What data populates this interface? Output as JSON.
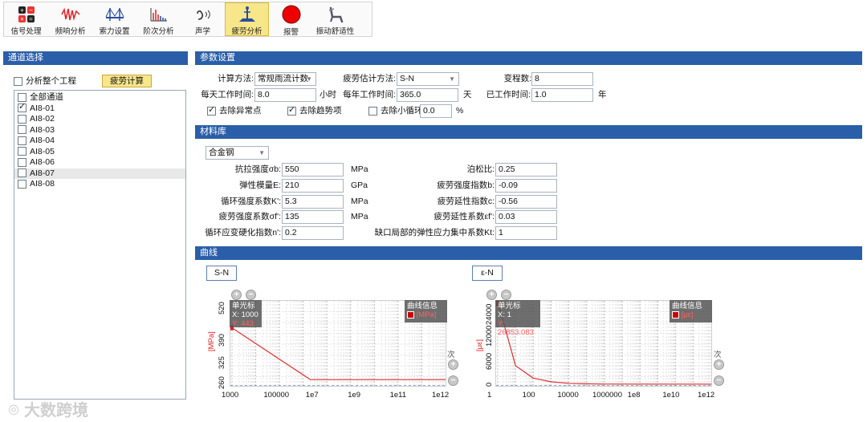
{
  "toolbar": {
    "items": [
      {
        "label": "信号处理",
        "icon": "signal-processing-icon"
      },
      {
        "label": "频响分析",
        "icon": "frequency-response-icon"
      },
      {
        "label": "索力设置",
        "icon": "cable-force-icon"
      },
      {
        "label": "阶次分析",
        "icon": "order-analysis-icon"
      },
      {
        "label": "声学",
        "icon": "acoustics-icon"
      },
      {
        "label": "疲劳分析",
        "icon": "fatigue-analysis-icon"
      },
      {
        "label": "报警",
        "icon": "alarm-icon"
      },
      {
        "label": "振动舒适性",
        "icon": "vibration-comfort-icon"
      }
    ],
    "active_index": 5,
    "accent": "#f8e68a"
  },
  "channels": {
    "header": "通道选择",
    "analyze_project_label": "分析整个工程",
    "fatigue_calc_button": "疲劳计算",
    "items": [
      {
        "label": "全部通道",
        "checked": false,
        "selected": false
      },
      {
        "label": "AI8-01",
        "checked": true,
        "selected": false
      },
      {
        "label": "AI8-02",
        "checked": false,
        "selected": false
      },
      {
        "label": "AI8-03",
        "checked": false,
        "selected": false
      },
      {
        "label": "AI8-04",
        "checked": false,
        "selected": false
      },
      {
        "label": "AI8-05",
        "checked": false,
        "selected": false
      },
      {
        "label": "AI8-06",
        "checked": false,
        "selected": false
      },
      {
        "label": "AI8-07",
        "checked": false,
        "selected": true
      },
      {
        "label": "AI8-08",
        "checked": false,
        "selected": false
      }
    ]
  },
  "params": {
    "header": "参数设置",
    "calc_method_label": "计算方法:",
    "calc_method_value": "常规雨流计数",
    "estimate_method_label": "疲劳估计方法:",
    "estimate_method_value": "S-N",
    "var_count_label": "变程数:",
    "var_count_value": "8",
    "daily_hours_label": "每天工作时间:",
    "daily_hours_value": "8.0",
    "daily_hours_unit": "小时",
    "yearly_days_label": "每年工作时间:",
    "yearly_days_value": "365.0",
    "yearly_days_unit": "天",
    "worked_label": "已工作时间:",
    "worked_value": "1.0",
    "worked_unit": "年",
    "remove_outliers_label": "去除异常点",
    "remove_trend_label": "去除趋势项",
    "remove_small_label": "去除小循环",
    "remove_small_value": "0.0",
    "remove_small_unit": "%"
  },
  "material": {
    "header": "材料库",
    "material_value": "合金钢",
    "tensile_label": "抗拉强度σb:",
    "tensile_value": "550",
    "tensile_unit": "MPa",
    "elastic_label": "弹性模量E:",
    "elastic_value": "210",
    "elastic_unit": "GPa",
    "cyc_strength_label": "循环强度系数K':",
    "cyc_strength_value": "5.3",
    "cyc_strength_unit": "MPa",
    "fat_strength_label": "疲劳强度系数σf':",
    "fat_strength_value": "135",
    "fat_strength_unit": "MPa",
    "hardening_label": "循环应变硬化指数n':",
    "hardening_value": "0.2",
    "poisson_label": "泊松比:",
    "poisson_value": "0.25",
    "fat_strength_exp_label": "疲劳强度指数b:",
    "fat_strength_exp_value": "-0.09",
    "fat_ductility_exp_label": "疲劳延性指数c:",
    "fat_ductility_exp_value": "-0.56",
    "fat_ductility_coef_label": "疲劳延性系数εf':",
    "fat_ductility_coef_value": "0.03",
    "kt_label": "缺口局部的弹性应力集中系数Kt:",
    "kt_value": "1"
  },
  "curves": {
    "header": "曲线",
    "sn_button": "S-N",
    "en_button": "ε-N",
    "cursor_title": "单光标",
    "curve_info_title": "曲线信息",
    "sn": {
      "cursor_x": "X: 1000",
      "cursor_y": "Y: 443",
      "unit_legend": "[MPa]",
      "ylabel": "[MPa]",
      "count_label": "次",
      "y_ticks": [
        "520",
        "390",
        "325",
        "260"
      ],
      "x_ticks": [
        "1000",
        "100000",
        "1e7",
        "1e9",
        "1e11",
        "1e12"
      ]
    },
    "en": {
      "cursor_x": "X: 1",
      "cursor_y": "Y: 26853.083",
      "unit_legend": "[με]",
      "ylabel": "[με]",
      "count_label": "次",
      "y_ticks": [
        "24000",
        "12000",
        "6000",
        "0"
      ],
      "x_ticks": [
        "1",
        "100",
        "10000",
        "1000000",
        "1e8",
        "1e10",
        "1e12"
      ]
    }
  },
  "chart_data": [
    {
      "type": "line",
      "title": "S-N",
      "xscale": "log",
      "xlim": [
        1000,
        1000000000000
      ],
      "ylim": [
        260,
        520
      ],
      "x": [
        1000,
        2000000,
        1000000000000
      ],
      "y": [
        443,
        275,
        275
      ],
      "color": "#e03030"
    },
    {
      "type": "line",
      "title": "ε-N",
      "xscale": "log",
      "xlim": [
        1,
        1000000000000
      ],
      "ylim": [
        0,
        26000
      ],
      "x": [
        1,
        10,
        100,
        1000,
        10000,
        100000,
        1000000,
        1000000000000
      ],
      "y": [
        26853.083,
        6000,
        2000,
        800,
        300,
        150,
        80,
        50
      ],
      "color": "#e03030"
    }
  ],
  "watermark": "大数跨境"
}
